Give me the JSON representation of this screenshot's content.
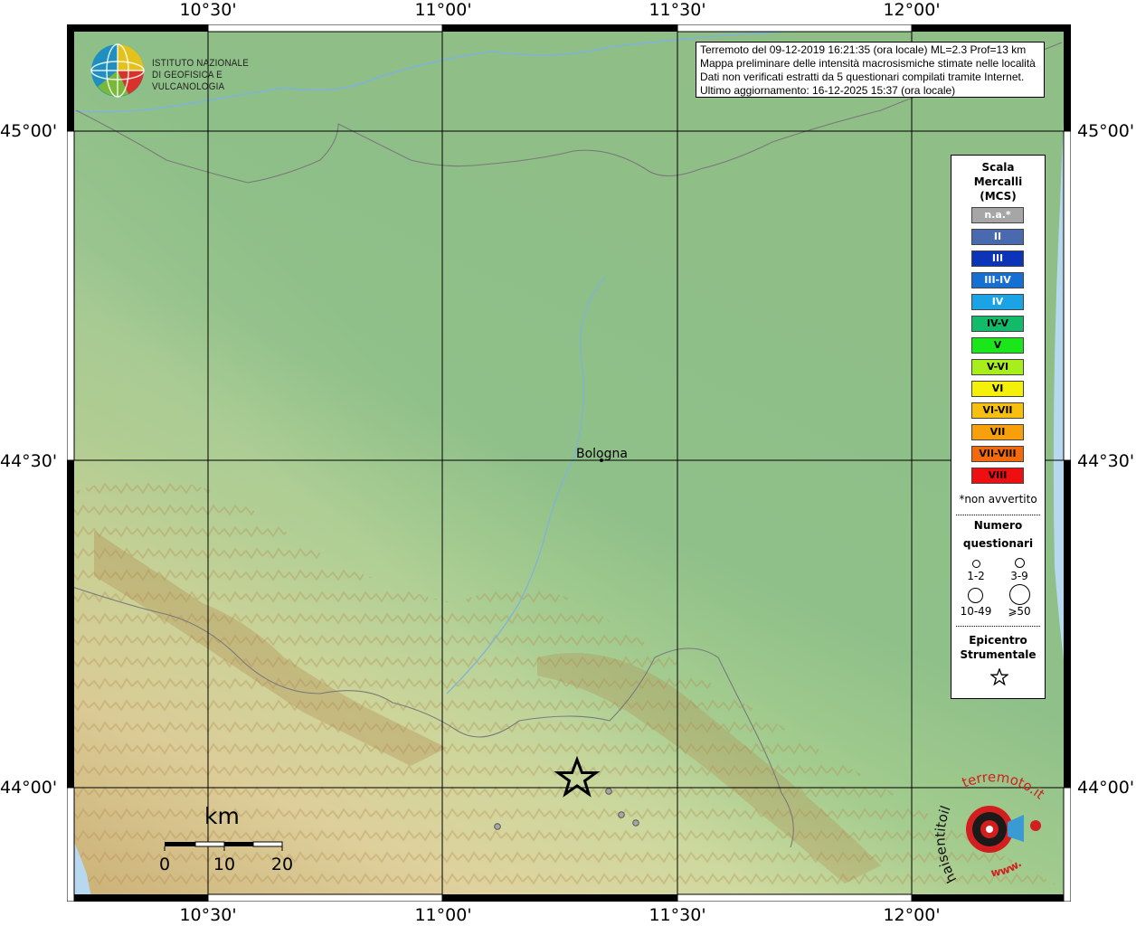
{
  "axes": {
    "top_labels": [
      "10°30'",
      "11°00'",
      "11°30'",
      "12°00'"
    ],
    "bottom_labels": [
      "10°30'",
      "11°00'",
      "11°30'",
      "12°00'"
    ],
    "left_labels": [
      "45°00'",
      "44°30'",
      "44°00'"
    ],
    "right_labels": [
      "45°00'",
      "44°30'",
      "44°00'"
    ]
  },
  "info": {
    "line1": "Terremoto del 09-12-2019 16:21:35 (ora locale) ML=2.3 Prof=13 km",
    "line2": "Mappa preliminare delle intensità macrosismiche stimate nelle località",
    "line3": "Dati non verificati estratti da 5 questionari compilati tramite Internet.",
    "line4": "Ultimo aggiornamento: 16-12-2025 15:37 (ora locale)"
  },
  "logo": {
    "line1": "ISTITUTO NAZIONALE",
    "line2": "DI GEOFISICA E VULCANOLOGIA"
  },
  "city": {
    "name": "Bologna"
  },
  "legend": {
    "title1": "Scala",
    "title2": "Mercalli",
    "title3": "(MCS)",
    "items": [
      {
        "label": "n.a.*",
        "color": "#a6a6a6",
        "text": "#ffffff"
      },
      {
        "label": "II",
        "color": "#4a6ab0",
        "text": "#ffffff"
      },
      {
        "label": "III",
        "color": "#0c34b8",
        "text": "#ffffff"
      },
      {
        "label": "III-IV",
        "color": "#1670d2",
        "text": "#ffffff"
      },
      {
        "label": "IV",
        "color": "#1aa4e6",
        "text": "#ffffff"
      },
      {
        "label": "IV-V",
        "color": "#12bb6a",
        "text": "#000000"
      },
      {
        "label": "V",
        "color": "#1ae61a",
        "text": "#000000"
      },
      {
        "label": "V-VI",
        "color": "#a8ee1a",
        "text": "#000000"
      },
      {
        "label": "VI",
        "color": "#f4f00a",
        "text": "#000000"
      },
      {
        "label": "VI-VII",
        "color": "#f8c00e",
        "text": "#000000"
      },
      {
        "label": "VII",
        "color": "#f8a00c",
        "text": "#000000"
      },
      {
        "label": "VII-VIII",
        "color": "#f46a0a",
        "text": "#000000"
      },
      {
        "label": "VIII",
        "color": "#ee1010",
        "text": "#000000"
      }
    ],
    "note": "*non avvertito",
    "count_title1": "Numero",
    "count_title2": "questionari",
    "count_labels": [
      "1-2",
      "3-9",
      "10-49",
      "⩾50"
    ],
    "epi_title1": "Epicentro",
    "epi_title2": "Strumentale"
  },
  "scalebar": {
    "unit": "km",
    "ticks": [
      "0",
      "10",
      "20"
    ]
  },
  "hsit_logo": {
    "text1": "haisentitoil",
    "text2": "terremoto.it",
    "text3": "www."
  }
}
